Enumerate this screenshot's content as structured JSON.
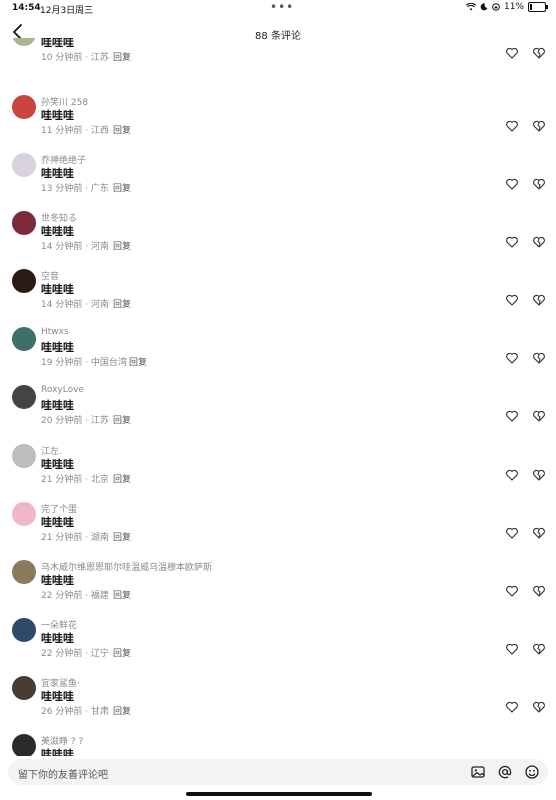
{
  "status": {
    "time": "14:54",
    "date": "12月3日周三",
    "battery": "11%",
    "battery_level": 0.11
  },
  "nav": {
    "title": "88 条评论"
  },
  "comments": [
    {
      "user": "",
      "text": "哇哇哇",
      "time": "10 分钟前",
      "loc": "江苏",
      "reply": "回复",
      "color": "#a9b58f"
    },
    {
      "user": "孙笑川 258",
      "text": "哇哇哇",
      "time": "11 分钟前",
      "loc": "江西",
      "reply": "回复",
      "color": "#c9443c"
    },
    {
      "user": "乔神绝绝子",
      "text": "哇哇哇",
      "time": "13 分钟前",
      "loc": "广东",
      "reply": "回复",
      "color": "#d7d2dc"
    },
    {
      "user": "世冬知る",
      "text": "哇哇哇",
      "time": "14 分钟前",
      "loc": "河南",
      "reply": "回复",
      "color": "#7a2a3a"
    },
    {
      "user": "空音",
      "text": "哇哇哇",
      "time": "14 分钟前",
      "loc": "河南",
      "reply": "回复",
      "color": "#2a1a14"
    },
    {
      "user": "Htwxs",
      "text": "哇哇哇",
      "time": "19 分钟前",
      "loc": "中国台湾",
      "reply": "回复",
      "color": "#3f6f6a"
    },
    {
      "user": "RoxyLove",
      "text": "哇哇哇",
      "time": "20 分钟前",
      "loc": "江苏",
      "reply": "回复",
      "color": "#444444"
    },
    {
      "user": "江左.",
      "text": "哇哇哇",
      "time": "21 分钟前",
      "loc": "北京",
      "reply": "回复",
      "color": "#bdbdbd"
    },
    {
      "user": "完了个蛋",
      "text": "哇哇哇",
      "time": "21 分钟前",
      "loc": "湖南",
      "reply": "回复",
      "color": "#efb7c8"
    },
    {
      "user": "乌木威尔维恩恩耶尔哇温威乌温穆本欧萨斯",
      "text": "哇哇哇",
      "time": "22 分钟前",
      "loc": "福建",
      "reply": "回复",
      "color": "#8a7a5a"
    },
    {
      "user": "一朵鲜花",
      "text": "哇哇哇",
      "time": "22 分钟前",
      "loc": "辽宁",
      "reply": "回复",
      "color": "#2e4a6b"
    },
    {
      "user": "宜家鲨鱼·",
      "text": "哇哇哇",
      "time": "26 分钟前",
      "loc": "甘肃",
      "reply": "回复",
      "color": "#4a3a32"
    },
    {
      "user": "美滋睁 ? ?",
      "text": "哇哇哇",
      "time": "",
      "loc": "",
      "reply": "",
      "color": "#2b2b2b"
    }
  ],
  "input": {
    "placeholder": "留下你的友善评论吧"
  }
}
